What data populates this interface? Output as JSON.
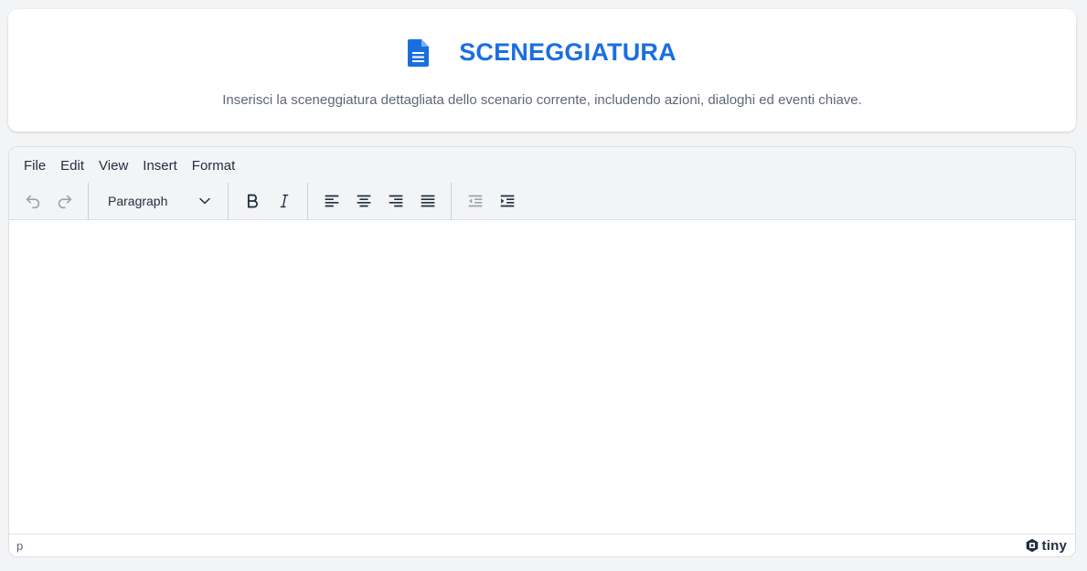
{
  "header": {
    "icon": "document-icon",
    "title": "SCENEGGIATURA",
    "subtitle": "Inserisci la sceneggiatura dettagliata dello scenario corrente, includendo azioni, dialoghi ed eventi chiave.",
    "accent_color": "#1a6fe0"
  },
  "editor": {
    "menubar": [
      "File",
      "Edit",
      "View",
      "Insert",
      "Format"
    ],
    "toolbar": {
      "undo_icon": "undo-icon",
      "redo_icon": "redo-icon",
      "block_format": "Paragraph",
      "bold_icon": "bold-icon",
      "italic_icon": "italic-icon",
      "align_icons": [
        "align-left-icon",
        "align-center-icon",
        "align-right-icon",
        "align-justify-icon"
      ],
      "indent_icons": [
        "outdent-icon",
        "indent-icon"
      ]
    },
    "content": "",
    "statusbar": {
      "path": "p",
      "brand": "tiny"
    }
  }
}
